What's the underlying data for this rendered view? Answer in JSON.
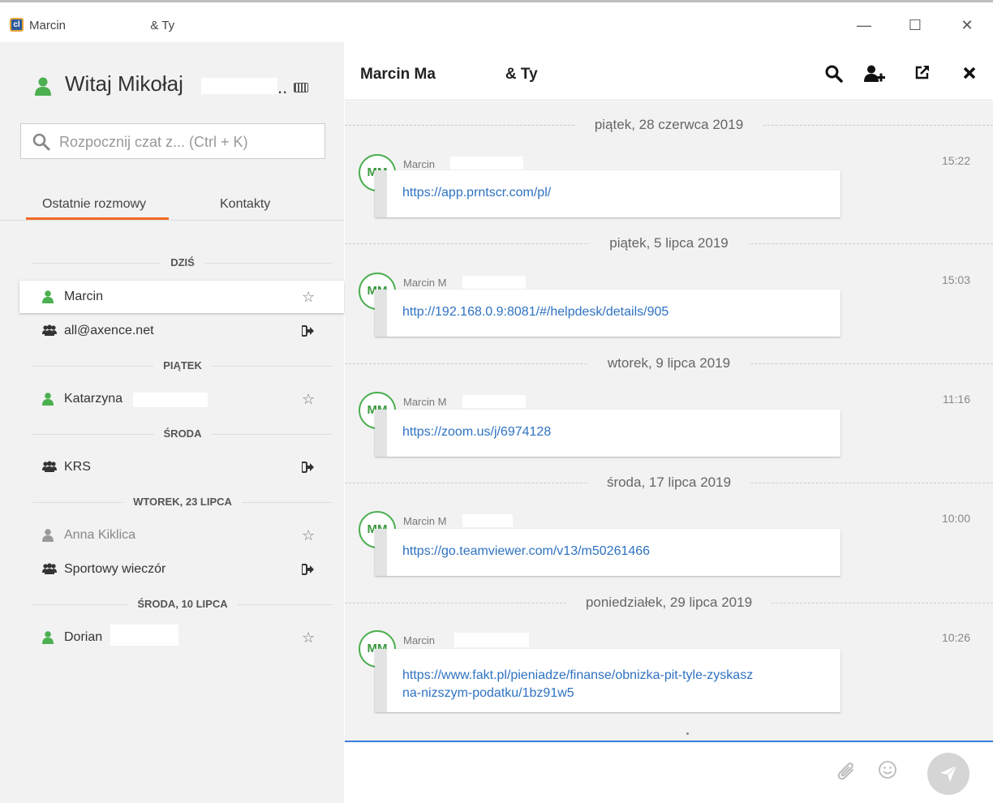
{
  "window": {
    "logo": "cl",
    "title_part1": "Marcin",
    "title_part2": "& Ty",
    "controls": {
      "minimize": "—",
      "maximize": "☐",
      "close": "✕"
    }
  },
  "sidebar": {
    "greeting_prefix": "Witaj Mikołaj",
    "greeting_suffix": "..",
    "search_placeholder": "Rozpocznij czat z... (Ctrl + K)",
    "tabs": [
      "Ostatnie rozmowy",
      "Kontakty"
    ],
    "active_tab": "Ostatnie rozmowy",
    "separators": [
      "DZIŚ",
      "PIĄTEK",
      "ŚRODA",
      "WTOREK, 23 LIPCA",
      "ŚRODA, 10 LIPCA"
    ],
    "conversations": [
      {
        "name": "Marcin",
        "type": "user",
        "status": "online",
        "action": "star-icon"
      },
      {
        "name": "all@axence.net",
        "type": "group",
        "action": "sign-out-icon"
      },
      {
        "name": "Katarzyna",
        "type": "user",
        "status": "online",
        "action": "star-icon"
      },
      {
        "name": "KRS",
        "type": "group",
        "action": "sign-out-icon"
      },
      {
        "name": "Anna Kiklica",
        "type": "user",
        "status": "offline",
        "action": "star-icon"
      },
      {
        "name": "Sportowy wieczór",
        "type": "group",
        "action": "sign-out-icon"
      },
      {
        "name": "Dorian",
        "type": "user",
        "status": "online",
        "action": "star-icon"
      }
    ]
  },
  "chat": {
    "title_part1": "Marcin Ma",
    "title_part2": "& Ty",
    "header_icons": [
      "search-icon",
      "add-user-icon",
      "external-link-icon",
      "close-icon"
    ],
    "dates": [
      "piątek, 28 czerwca 2019",
      "piątek, 5 lipca 2019",
      "wtorek, 9 lipca 2019",
      "środa, 17 lipca 2019",
      "poniedziałek, 29 lipca 2019"
    ],
    "messages": [
      {
        "initials": "MM",
        "sender": "Marcin",
        "time": "15:22",
        "text": "https://app.prntscr.com/pl/"
      },
      {
        "initials": "MM",
        "sender": "Marcin M",
        "time": "15:03",
        "text": "http://192.168.0.9:8081/#/helpdesk/details/905"
      },
      {
        "initials": "MM",
        "sender": "Marcin M",
        "time": "11:16",
        "text": "https://zoom.us/j/6974128"
      },
      {
        "initials": "MM",
        "sender": "Marcin M",
        "time": "10:00",
        "text": "https://go.teamviewer.com/v13/m50261466"
      },
      {
        "initials": "MM",
        "sender": "Marcin",
        "time": "10:26",
        "text_line1": "https://www.fakt.pl/pieniadze/finanse/obnizka-pit-tyle-zyskasz",
        "text_line2": "na-nizszym-podatku/1bz91w5"
      }
    ]
  },
  "colors": {
    "accent_orange": "#f26b24",
    "online_green": "#4caf50",
    "link_blue": "#2e72c2",
    "compose_border": "#3b7dd8"
  }
}
